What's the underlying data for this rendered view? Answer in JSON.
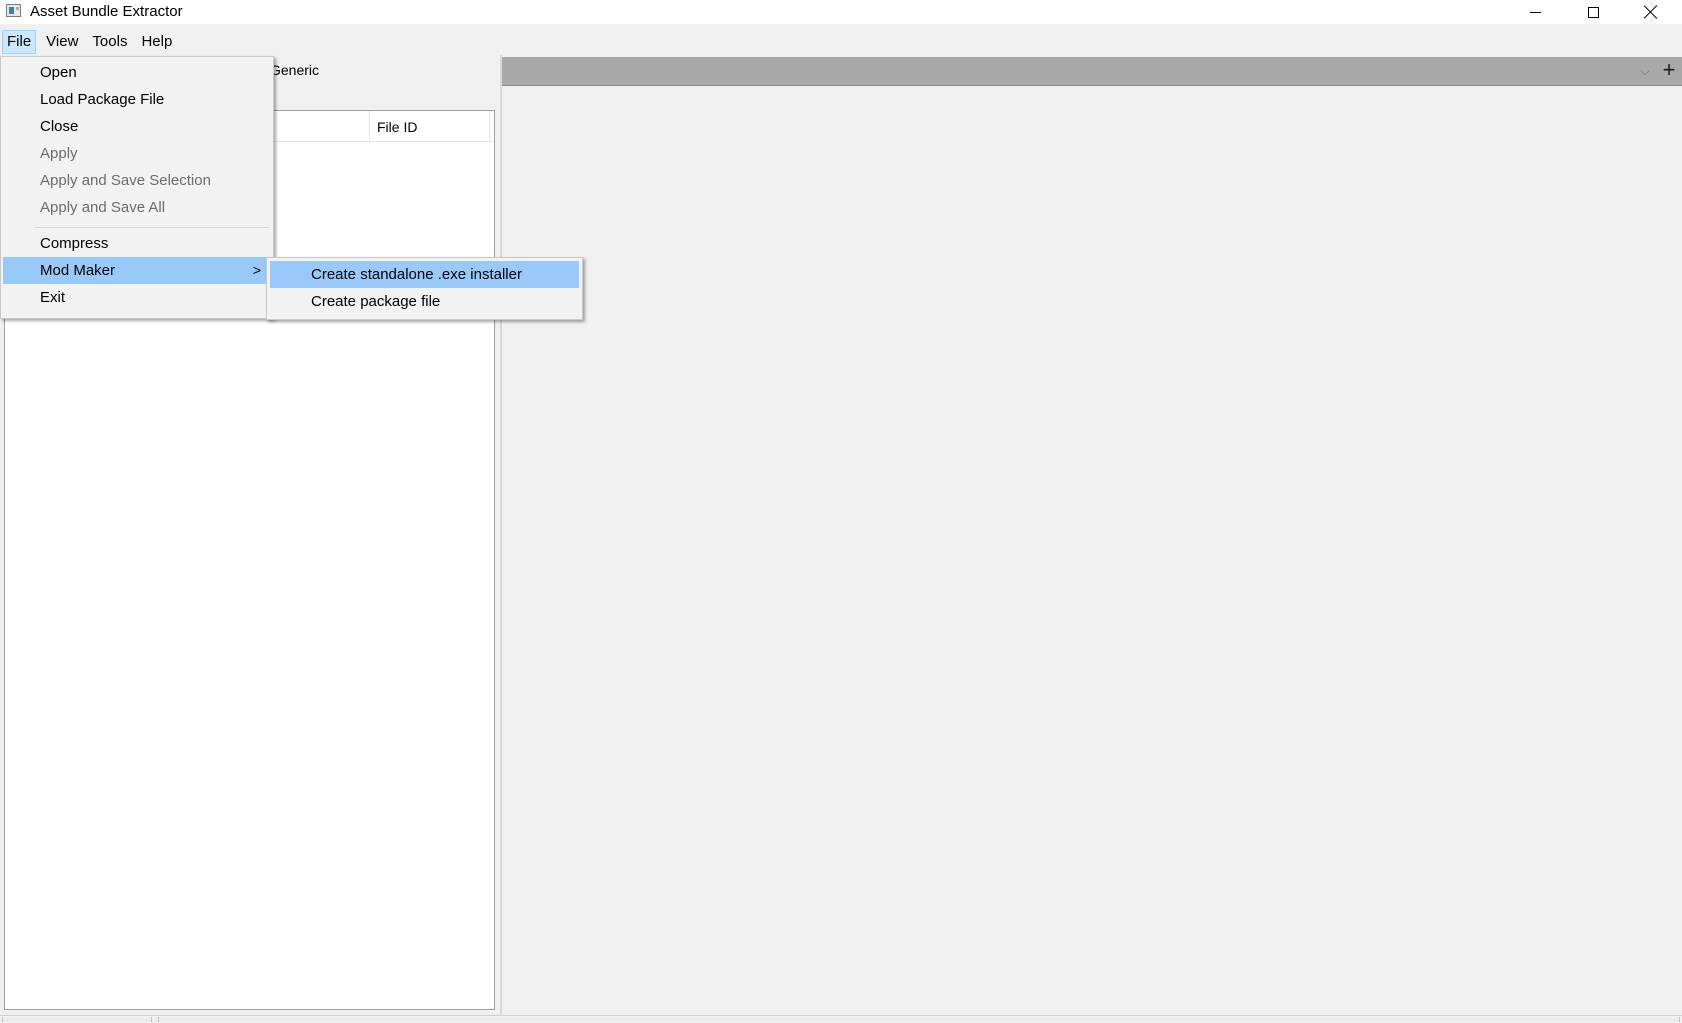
{
  "window": {
    "title": "Asset Bundle Extractor",
    "controls": [
      "minimize-icon",
      "maximize-icon",
      "close-icon"
    ]
  },
  "menubar": {
    "items": [
      {
        "label": "File",
        "active": true
      },
      {
        "label": "View",
        "active": false
      },
      {
        "label": "Tools",
        "active": false
      },
      {
        "label": "Help",
        "active": false
      }
    ]
  },
  "left_panel": {
    "partial_label": "Generic",
    "file_list": {
      "columns": [
        "",
        "File ID"
      ]
    }
  },
  "right_panel": {
    "tab_add_symbol": "+",
    "tab_dropdown_symbol": "⌵"
  },
  "file_menu": {
    "items": [
      {
        "label": "Open",
        "enabled": true
      },
      {
        "label": "Load Package File",
        "enabled": true
      },
      {
        "label": "Close",
        "enabled": true
      },
      {
        "label": "Apply",
        "enabled": false
      },
      {
        "label": "Apply and Save Selection",
        "enabled": false
      },
      {
        "label": "Apply and Save All",
        "enabled": false
      },
      {
        "separator": true
      },
      {
        "label": "Compress",
        "enabled": true
      },
      {
        "label": "Mod Maker",
        "enabled": true,
        "highlighted": true,
        "submenu": true,
        "arrow": ">"
      },
      {
        "label": "Exit",
        "enabled": true
      }
    ]
  },
  "mod_maker_submenu": {
    "items": [
      {
        "label": "Create standalone .exe installer",
        "highlighted": true
      },
      {
        "label": "Create package file",
        "highlighted": false
      }
    ]
  },
  "colors": {
    "menu_highlight": "#99c9f9",
    "menubar_active_bg": "#cce8ff",
    "tabbar_bg": "#a9a9a9",
    "window_bg": "#f0f0f0"
  }
}
